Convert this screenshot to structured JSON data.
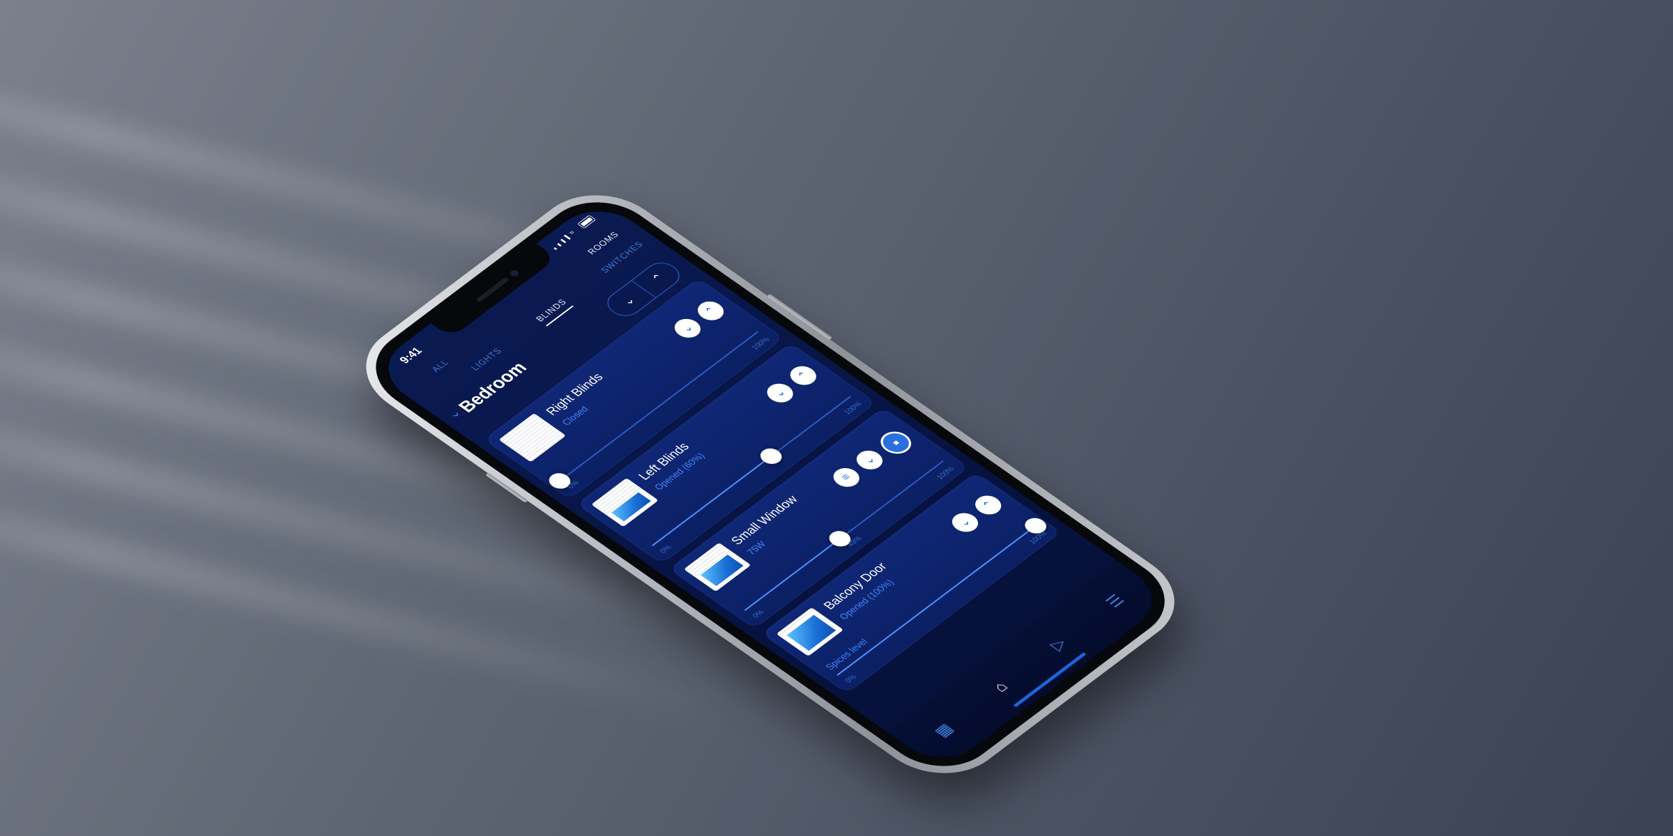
{
  "status_bar": {
    "time": "9:41"
  },
  "tabs_top": [
    "ALL",
    "ROOMS"
  ],
  "tabs_second": [
    "LIGHTS",
    "BLINDS",
    "SWITCHES"
  ],
  "room": {
    "title": "Bedroom"
  },
  "bulk_control": {
    "down_icon": "chevron-down-icon",
    "up_icon": "chevron-up-icon"
  },
  "cards": [
    {
      "name": "Right Blinds",
      "status": "Closed",
      "min_label": "0%",
      "max_label": "100%",
      "level": 0.0,
      "has_stop": false
    },
    {
      "name": "Left Blinds",
      "status": "Opened (60%)",
      "min_label": "0%",
      "max_label": "100%",
      "level": 0.6,
      "has_stop": false
    },
    {
      "name": "Small Window",
      "status": "75W",
      "min_label": "0%",
      "max_label": "100%",
      "level": 0.48,
      "level_label": "48%",
      "has_stop": true
    },
    {
      "name": "Balcony Door",
      "status": "Opened (100%)",
      "subtitle": "Spices level",
      "min_label": "0%",
      "max_label": "100%",
      "level": 1.0,
      "has_stop": false
    }
  ],
  "bottom_nav": [
    "grid-icon",
    "home-icon",
    "play-icon",
    "menu-icon"
  ],
  "colors": {
    "accent": "#2a6fe0",
    "screen_bg": "#071443",
    "card_bg": "#0d2268"
  }
}
